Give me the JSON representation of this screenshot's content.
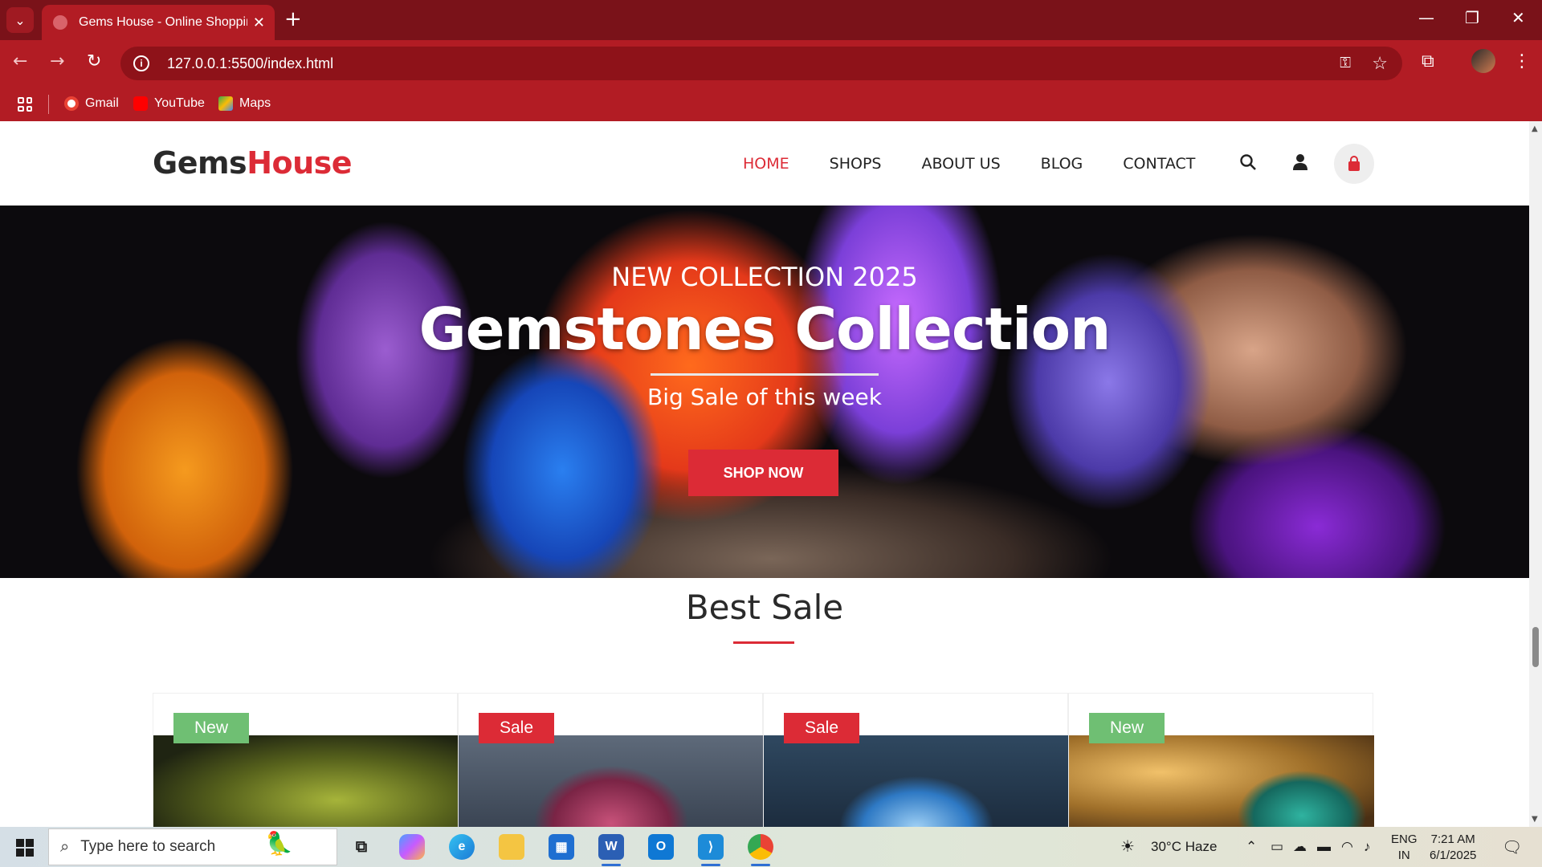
{
  "browser": {
    "tab_title": "Gems House - Online Shopping",
    "url": "127.0.0.1:5500/index.html",
    "bookmarks": [
      {
        "label": "Gmail",
        "color": "#ea4335"
      },
      {
        "label": "YouTube",
        "color": "#ff0000"
      },
      {
        "label": "Maps",
        "color": "#34a853"
      }
    ]
  },
  "site": {
    "logo_part1": "Gems",
    "logo_part2": "House",
    "nav": [
      {
        "label": "HOME",
        "active": true
      },
      {
        "label": "SHOPS",
        "active": false
      },
      {
        "label": "ABOUT US",
        "active": false
      },
      {
        "label": "BLOG",
        "active": false
      },
      {
        "label": "CONTACT",
        "active": false
      }
    ],
    "accent_color": "#dc2b36"
  },
  "hero": {
    "subtitle": "NEW COLLECTION 2025",
    "title": "Gemstones Collection",
    "tagline": "Big Sale of this week",
    "button": "SHOP NOW"
  },
  "best_sale": {
    "title": "Best Sale",
    "products": [
      {
        "badge": "New",
        "badge_type": "new"
      },
      {
        "badge": "Sale",
        "badge_type": "sale"
      },
      {
        "badge": "Sale",
        "badge_type": "sale"
      },
      {
        "badge": "New",
        "badge_type": "new"
      }
    ]
  },
  "taskbar": {
    "search_placeholder": "Type here to search",
    "weather": "30°C  Haze",
    "lang_line1": "ENG",
    "lang_line2": "IN",
    "time": "7:21 AM",
    "date": "6/1/2025"
  }
}
